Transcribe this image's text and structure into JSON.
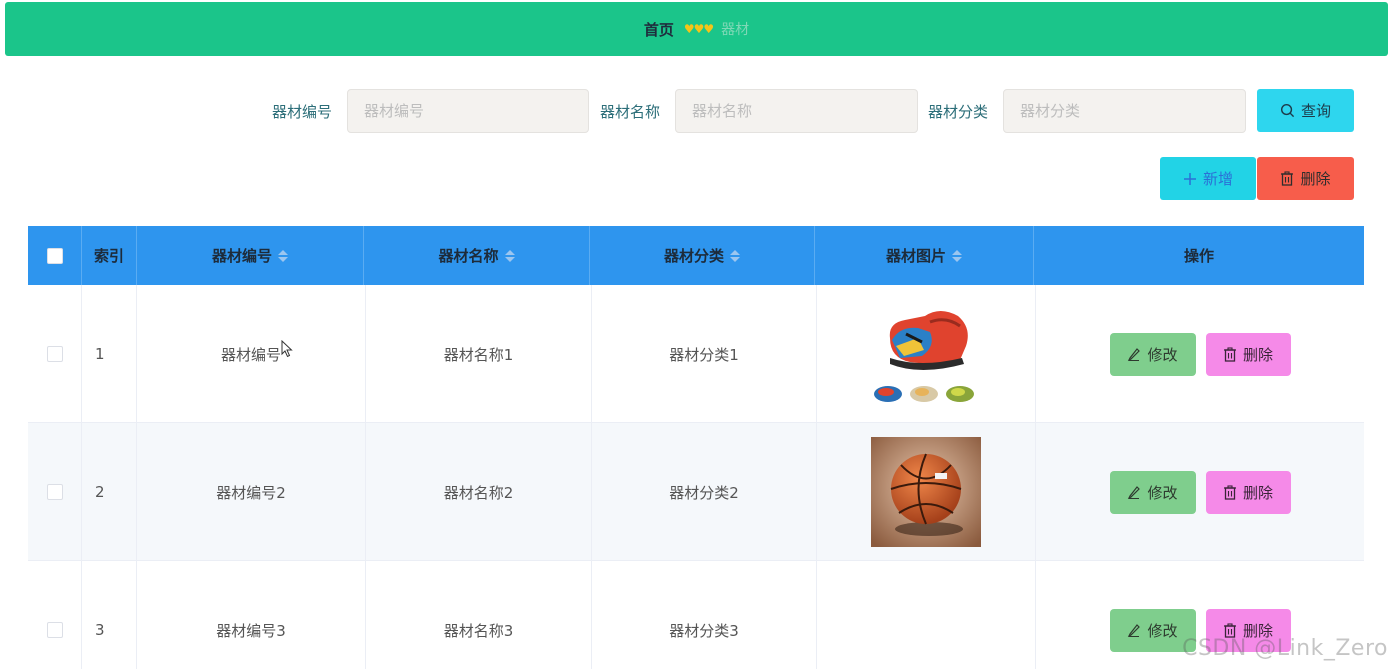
{
  "breadcrumb": {
    "home": "首页",
    "separator": "♥♥♥",
    "current": "器材"
  },
  "search": {
    "fields": [
      {
        "label": "器材编号",
        "placeholder": "器材编号"
      },
      {
        "label": "器材名称",
        "placeholder": "器材名称"
      },
      {
        "label": "器材分类",
        "placeholder": "器材分类"
      }
    ],
    "query_label": "查询"
  },
  "actions": {
    "add_label": "新增",
    "delete_label": "删除"
  },
  "table": {
    "headers": {
      "index": "索引",
      "code": "器材编号",
      "name": "器材名称",
      "category": "器材分类",
      "image": "器材图片",
      "operation": "操作"
    },
    "rows": [
      {
        "index": "1",
        "code": "器材编号",
        "name": "器材名称1",
        "category": "器材分类1",
        "image": "sneakers",
        "edit": "修改",
        "delete": "删除"
      },
      {
        "index": "2",
        "code": "器材编号2",
        "name": "器材名称2",
        "category": "器材分类2",
        "image": "basketball",
        "edit": "修改",
        "delete": "删除"
      },
      {
        "index": "3",
        "code": "器材编号3",
        "name": "器材名称3",
        "category": "器材分类3",
        "image": "",
        "edit": "修改",
        "delete": "删除"
      }
    ]
  },
  "watermark": "CSDN @Link_Zero",
  "colors": {
    "header_bar": "#1bc58a",
    "table_header": "#2e95ee",
    "query_button": "#2ed6ee",
    "add_button": "#22d3e6",
    "delete_button": "#f75d4b",
    "edit_button": "#7fce8d",
    "row_delete_button": "#f58ae8"
  },
  "icons": {
    "query": "search-icon",
    "add": "plus-icon",
    "delete": "trash-icon",
    "edit": "pencil-icon",
    "sort": "sort-caret-icon"
  }
}
